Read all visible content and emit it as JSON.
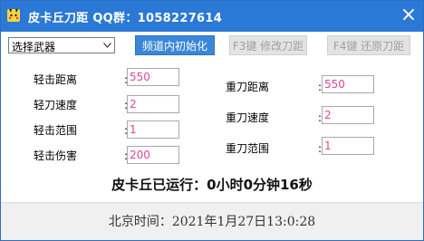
{
  "window": {
    "title": "皮卡丘刀距  QQ群：1058227614",
    "close_glyph": "×"
  },
  "toolbar": {
    "weapon_select": "选择武器",
    "btn_init": "频道内初始化",
    "btn_f3": "F3键 修改刀距",
    "btn_f4": "F4键 还原刀距"
  },
  "left_fields": [
    {
      "label": "轻击距离",
      "value": "550"
    },
    {
      "label": "轻刀速度",
      "value": "2"
    },
    {
      "label": "轻击范围",
      "value": "1"
    },
    {
      "label": "轻击伤害",
      "value": "200"
    }
  ],
  "right_fields": [
    {
      "label": "重刀距离",
      "value": "550"
    },
    {
      "label": "重刀速度",
      "value": "2"
    },
    {
      "label": "重刀范围",
      "value": "1"
    }
  ],
  "colon": ":",
  "runtime": "皮卡丘已运行：0小时0分钟16秒",
  "clock": "北京时间：2021年1月27日13:0:28",
  "colors": {
    "titlebar": "#2b79d6",
    "primary_button": "#3a86d8",
    "value_text": "#e0449a"
  }
}
